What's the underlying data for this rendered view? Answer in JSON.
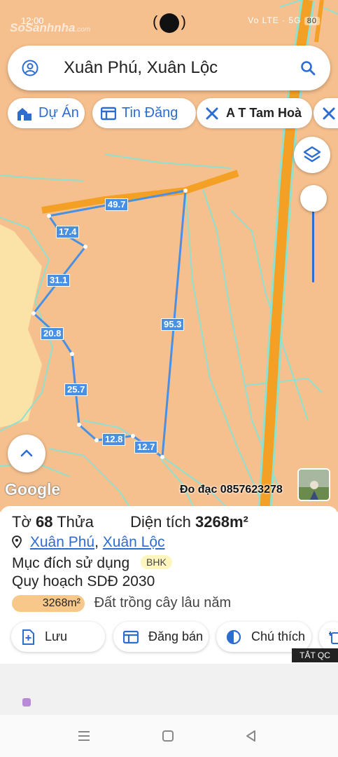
{
  "status": {
    "time": "12:00",
    "logo": "SoSanhnha",
    "logo_suffix": ".com",
    "right": "Vo LTE · 5G",
    "battery": "80"
  },
  "search": {
    "query": "Xuân Phú, Xuân Lộc"
  },
  "chips": [
    {
      "label": "Dự Án",
      "icon": "building-icon"
    },
    {
      "label": "Tin Đăng",
      "icon": "listing-icon"
    },
    {
      "label": "A T Tam Hoà",
      "icon": "tools-icon"
    }
  ],
  "parcel": {
    "segments": [
      "49.7",
      "17.4",
      "31.1",
      "20.8",
      "25.7",
      "12.8",
      "12.7",
      "95.3"
    ]
  },
  "map": {
    "watermark": "Google",
    "survey_contact": "Đo đạc 0857623278"
  },
  "info": {
    "to_label": "Tờ",
    "to_value": "68",
    "thua_label": "Thửa",
    "area_label": "Diện tích",
    "area_value": "3268m²",
    "location_a": "Xuân Phú",
    "location_sep": ",",
    "location_b": "Xuân Lộc",
    "purpose_label": "Mục đích sử dụng",
    "purpose_code": "BHK",
    "plan_label": "Quy hoạch SDĐ 2030",
    "plan_area": "3268m²",
    "plan_type": "Đất trồng cây lâu năm"
  },
  "actions": [
    {
      "label": "Lưu"
    },
    {
      "label": "Đăng bán"
    },
    {
      "label": "Chú thích"
    }
  ],
  "ad_badge": "TẮT QC",
  "colors": {
    "accent": "#2d6dd2",
    "map_land": "#f6c08e",
    "road": "#f4a025",
    "parcel_line": "#4a90e2"
  }
}
